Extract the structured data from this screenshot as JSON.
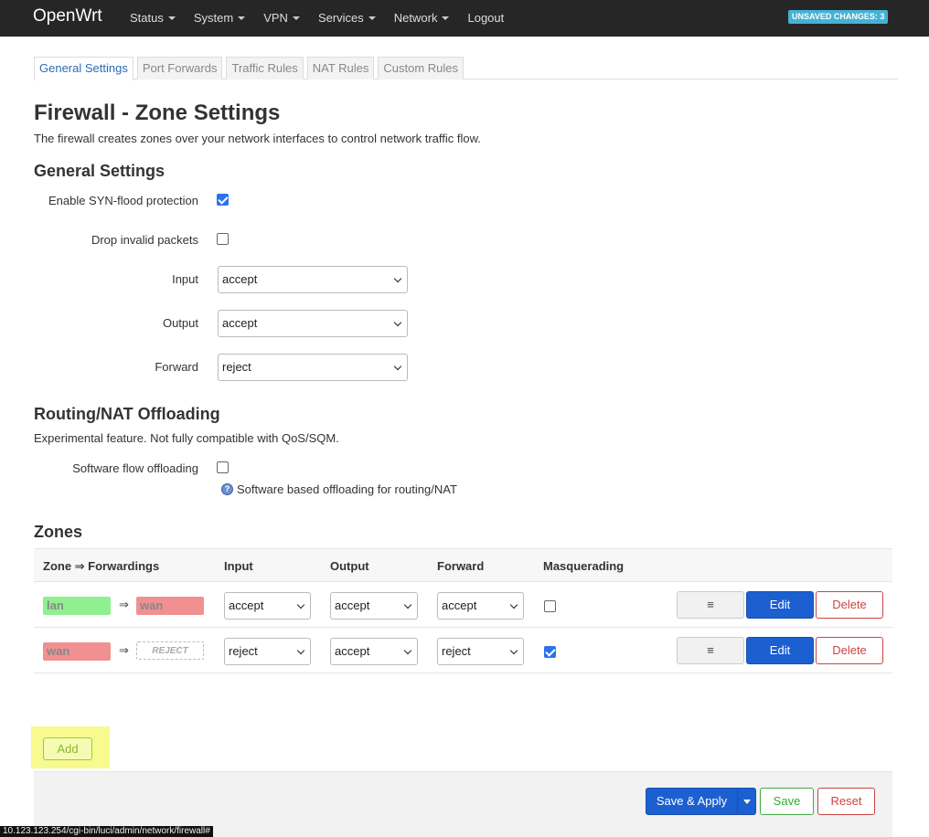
{
  "navbar": {
    "brand": "OpenWrt",
    "menu": [
      "Status",
      "System",
      "VPN",
      "Services",
      "Network",
      "Logout"
    ],
    "badge": "UNSAVED CHANGES: 3"
  },
  "tabs": [
    "General Settings",
    "Port Forwards",
    "Traffic Rules",
    "NAT Rules",
    "Custom Rules"
  ],
  "page": {
    "title": "Firewall - Zone Settings",
    "description": "The firewall creates zones over your network interfaces to control network traffic flow."
  },
  "general": {
    "heading": "General Settings",
    "syn_flood_label": "Enable SYN-flood protection",
    "syn_flood_checked": true,
    "drop_invalid_label": "Drop invalid packets",
    "drop_invalid_checked": false,
    "input_label": "Input",
    "input_value": "accept",
    "output_label": "Output",
    "output_value": "accept",
    "forward_label": "Forward",
    "forward_value": "reject"
  },
  "offloading": {
    "heading": "Routing/NAT Offloading",
    "description": "Experimental feature. Not fully compatible with QoS/SQM.",
    "software_label": "Software flow offloading",
    "software_checked": false,
    "help_text": "Software based offloading for routing/NAT"
  },
  "zones": {
    "heading": "Zones",
    "columns": [
      "Zone ⇒ Forwardings",
      "Input",
      "Output",
      "Forward",
      "Masquerading"
    ],
    "rows": [
      {
        "zone": "lan",
        "zone_color": "#90f090",
        "arrow": "⇒",
        "dest": "wan",
        "dest_color": "#f09090",
        "input": "accept",
        "output": "accept",
        "forward": "accept",
        "masq": false
      },
      {
        "zone": "wan",
        "zone_color": "#f09090",
        "arrow": "⇒",
        "dest": "REJECT",
        "dest_color": "#ffffff",
        "input": "reject",
        "output": "accept",
        "forward": "reject",
        "masq": true
      }
    ],
    "drag_label": "≡",
    "edit_label": "Edit",
    "delete_label": "Delete",
    "add_label": "Add"
  },
  "footer": {
    "save_apply": "Save & Apply",
    "save": "Save",
    "reset": "Reset"
  },
  "status_url": "10.123.123.254/cgi-bin/luci/admin/network/firewall#"
}
